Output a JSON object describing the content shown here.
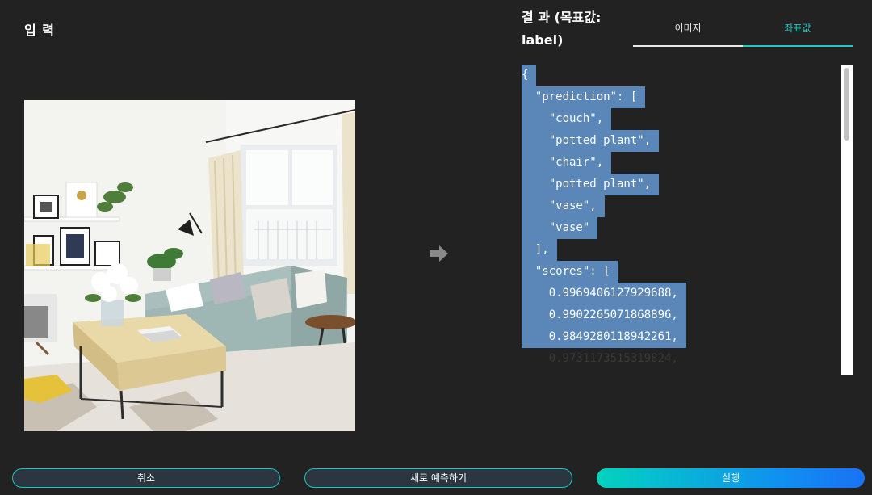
{
  "input": {
    "title": "입 력"
  },
  "result": {
    "title": "결 과 (목표값: label)"
  },
  "tabs": {
    "image": "이미지",
    "coords": "좌표값"
  },
  "code_lines": [
    "{",
    "  \"prediction\": [",
    "    \"couch\",",
    "    \"potted plant\",",
    "    \"chair\",",
    "    \"potted plant\",",
    "    \"vase\",",
    "    \"vase\"",
    "  ],",
    "  \"scores\": [",
    "    0.9969406127929688,",
    "    0.9902265071868896,",
    "    0.9849280118942261,",
    "    0.9731173515319824,"
  ],
  "buttons": {
    "cancel": "취소",
    "new_prediction": "새로 예측하기",
    "run": "실행"
  },
  "colors": {
    "accent": "#1fc8c0",
    "selection": "#5a87b8",
    "background": "#222222"
  },
  "icons": {
    "arrow": "arrow-right-icon"
  }
}
